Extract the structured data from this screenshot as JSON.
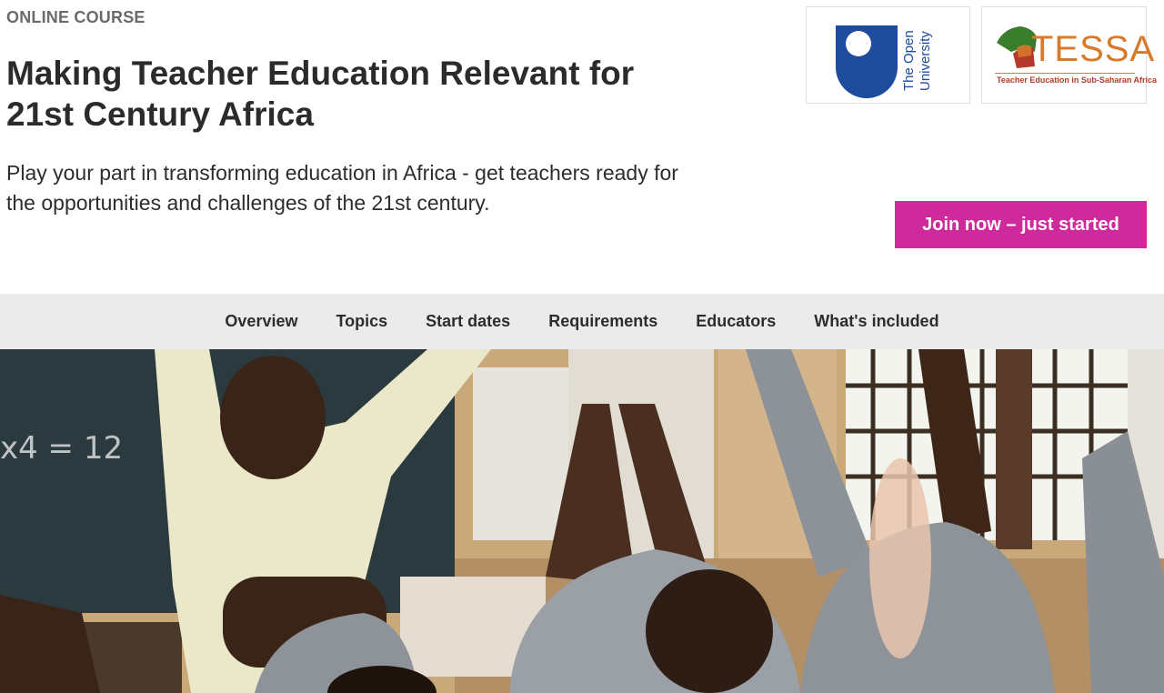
{
  "course": {
    "eyebrow": "ONLINE COURSE",
    "title": "Making Teacher Education Relevant for 21st Century Africa",
    "intro": "Play your part in transforming education in Africa - get teachers ready for the opportunities and challenges of the 21st century."
  },
  "logos": {
    "open_university": {
      "line1": "The Open",
      "line2": "University"
    },
    "tessa": {
      "word": "TESSA",
      "tagline": "Teacher Education in Sub-Saharan Africa"
    }
  },
  "cta": {
    "label": "Join now – just started",
    "color": "#cf2a9c"
  },
  "subnav": {
    "items": [
      {
        "label": "Overview"
      },
      {
        "label": "Topics"
      },
      {
        "label": "Start dates"
      },
      {
        "label": "Requirements"
      },
      {
        "label": "Educators"
      },
      {
        "label": "What's included"
      }
    ]
  },
  "hero": {
    "blackboard_text": "x4 = 12"
  },
  "colors": {
    "brand_blue": "#1e4c9c",
    "tessa_orange": "#d87a2b",
    "subnav_bg": "#ebebeb"
  }
}
